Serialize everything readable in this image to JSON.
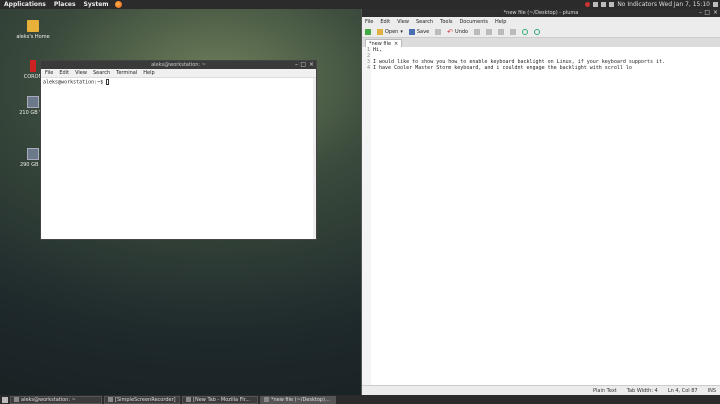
{
  "top_panel": {
    "menus": [
      "Applications",
      "Places",
      "System"
    ],
    "clock": "No Indicators  Wed Jan 7, 15:10"
  },
  "desktop_icons": [
    {
      "label": "aleks's Home",
      "icon": "home-folder-icon"
    },
    {
      "label": "CORON",
      "icon": "coronet-icon"
    },
    {
      "label": "210 GB Vol",
      "icon": "drive-icon"
    },
    {
      "label": "290 GB Vo",
      "icon": "drive-icon"
    }
  ],
  "terminal": {
    "title": "aleks@workstation: ~",
    "menus": [
      "File",
      "Edit",
      "View",
      "Search",
      "Terminal",
      "Help"
    ],
    "prompt": "aleks@workstation:~$ "
  },
  "pluma": {
    "title": "*new file (~/Desktop) - pluma",
    "menus": [
      "File",
      "Edit",
      "View",
      "Search",
      "Tools",
      "Documents",
      "Help"
    ],
    "toolbar": {
      "open": "Open",
      "save": "Save",
      "undo": "Undo"
    },
    "tab": {
      "label": "*new file",
      "close": "×"
    },
    "lines": [
      "Hi,",
      "",
      "I would like to show you how to enable keyboard backlight on Linux, if your keyboard supports it.",
      "I have Cooler Master Storm keyboard, and i couldnt engage the backlight with scroll lo"
    ],
    "status": {
      "lang": "Plain Text",
      "tab": "Tab Width: 4",
      "pos": "Ln 4, Col 87",
      "mode": "INS"
    }
  },
  "taskbar": [
    {
      "label": "aleks@workstation: ~"
    },
    {
      "label": "[SimpleScreenRecorder]"
    },
    {
      "label": "[New Tab - Mozilla Fir..."
    },
    {
      "label": "*new file (~/Desktop)..."
    }
  ]
}
